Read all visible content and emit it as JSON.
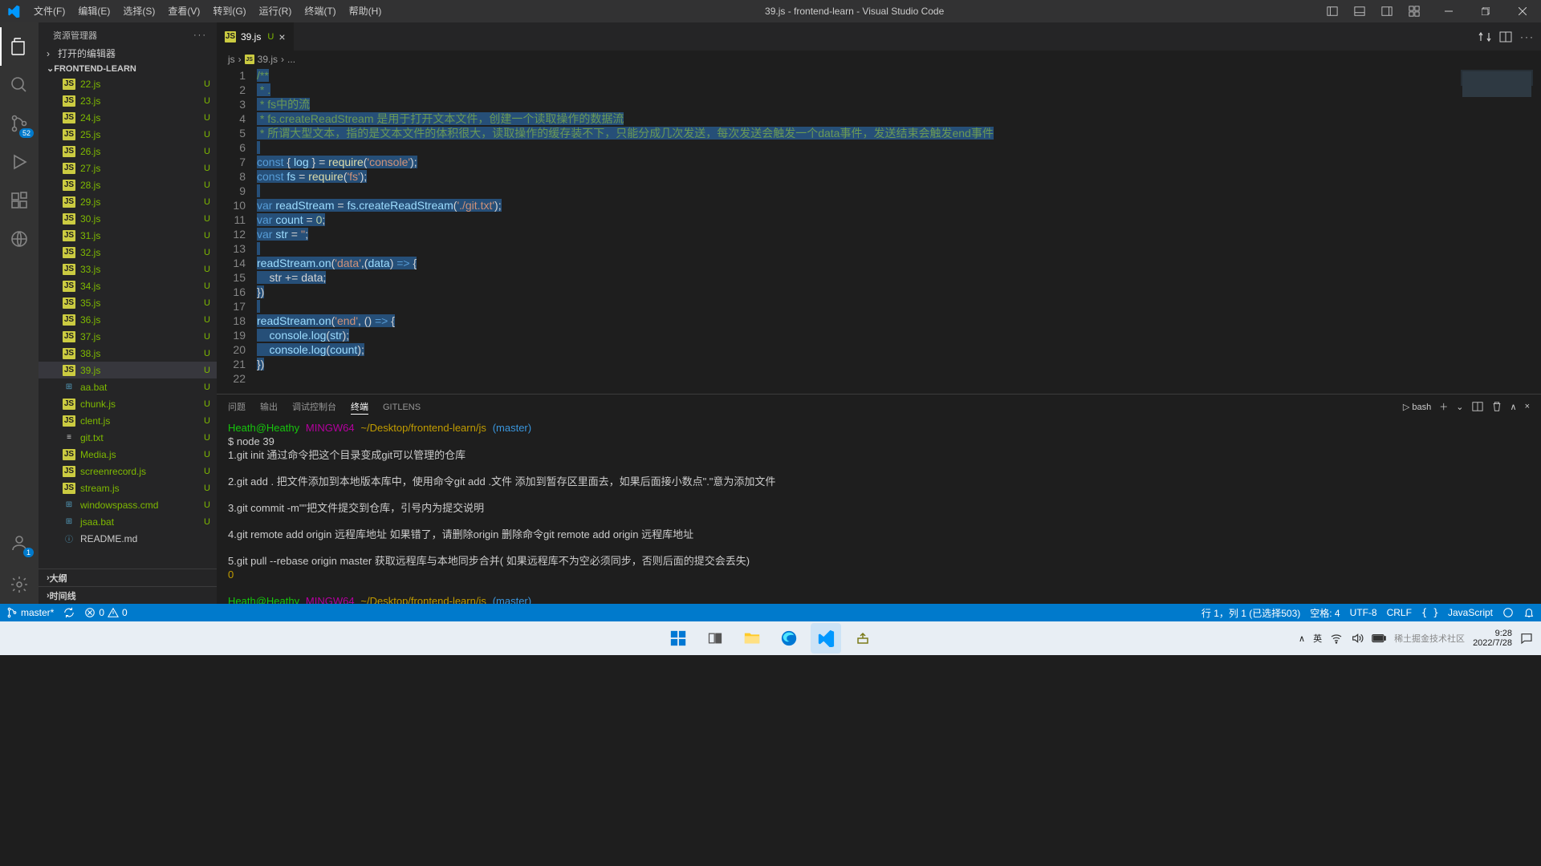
{
  "titlebar": {
    "menus": [
      "文件(F)",
      "编辑(E)",
      "选择(S)",
      "查看(V)",
      "转到(G)",
      "运行(R)",
      "终端(T)",
      "帮助(H)"
    ],
    "title": "39.js - frontend-learn - Visual Studio Code"
  },
  "sidebar": {
    "header": "资源管理器",
    "open_editors": "打开的编辑器",
    "folder": "FRONTEND-LEARN",
    "files": [
      {
        "name": "22.js",
        "type": "js",
        "status": "U"
      },
      {
        "name": "23.js",
        "type": "js",
        "status": "U"
      },
      {
        "name": "24.js",
        "type": "js",
        "status": "U"
      },
      {
        "name": "25.js",
        "type": "js",
        "status": "U"
      },
      {
        "name": "26.js",
        "type": "js",
        "status": "U"
      },
      {
        "name": "27.js",
        "type": "js",
        "status": "U"
      },
      {
        "name": "28.js",
        "type": "js",
        "status": "U"
      },
      {
        "name": "29.js",
        "type": "js",
        "status": "U"
      },
      {
        "name": "30.js",
        "type": "js",
        "status": "U"
      },
      {
        "name": "31.js",
        "type": "js",
        "status": "U"
      },
      {
        "name": "32.js",
        "type": "js",
        "status": "U"
      },
      {
        "name": "33.js",
        "type": "js",
        "status": "U"
      },
      {
        "name": "34.js",
        "type": "js",
        "status": "U"
      },
      {
        "name": "35.js",
        "type": "js",
        "status": "U"
      },
      {
        "name": "36.js",
        "type": "js",
        "status": "U"
      },
      {
        "name": "37.js",
        "type": "js",
        "status": "U"
      },
      {
        "name": "38.js",
        "type": "js",
        "status": "U"
      },
      {
        "name": "39.js",
        "type": "js",
        "status": "U",
        "active": true
      },
      {
        "name": "aa.bat",
        "type": "bat",
        "status": "U"
      },
      {
        "name": "chunk.js",
        "type": "js",
        "status": "U"
      },
      {
        "name": "clent.js",
        "type": "js",
        "status": "U"
      },
      {
        "name": "git.txt",
        "type": "txt",
        "status": "U"
      },
      {
        "name": "Media.js",
        "type": "js",
        "status": "U"
      },
      {
        "name": "screenrecord.js",
        "type": "js",
        "status": "U"
      },
      {
        "name": "stream.js",
        "type": "js",
        "status": "U"
      },
      {
        "name": "windowspass.cmd",
        "type": "bat",
        "status": "U"
      },
      {
        "name": "jsaa.bat",
        "type": "bat",
        "status": "U"
      },
      {
        "name": "README.md",
        "type": "md",
        "status": ""
      }
    ],
    "outline": "大纲",
    "timeline": "时间线"
  },
  "activitybar": {
    "scm_badge": "52",
    "accounts_badge": "1"
  },
  "tab": {
    "name": "39.js",
    "status": "U"
  },
  "breadcrumb": [
    "js",
    "39.js",
    "..."
  ],
  "code_lines": {
    "1": "/**",
    "2": " * .",
    "3": " * fs中的流",
    "4": " * fs.createReadStream 是用于打开文本文件，创建一个读取操作的数据流",
    "5": " * 所谓大型文本，指的是文本文件的体积很大，读取操作的缓存装不下，只能分成几次发送，每次发送会触发一个data事件，发送结束会触发end事件",
    "l7_const": "const",
    "l7_log": "log",
    "l7_require": "require",
    "l7_arg": "'console'",
    "l8_const": "const",
    "l8_fs": "fs",
    "l8_require": "require",
    "l8_arg": "'fs'",
    "l10_var": "var",
    "l10_rs": "readStream",
    "l10_call": "fs.createReadStream",
    "l10_arg": "'./git.txt'",
    "l11_var": "var",
    "l11_count": "count",
    "l11_val": "0",
    "l12_var": "var",
    "l12_str": "str",
    "l12_val": "''",
    "l14_rs": "readStream.on",
    "l14_ev": "'data'",
    "l14_param": "data",
    "l15_body": "    str += data;",
    "l18_rs": "readStream.on",
    "l18_ev": "'end'",
    "l19_log": "    console.log",
    "l19_arg": "str",
    "l20_log": "    console.log",
    "l20_arg": "count"
  },
  "panel": {
    "tabs": [
      "问题",
      "输出",
      "调试控制台",
      "终端",
      "GITLENS"
    ],
    "active_tab": 3,
    "shell": "bash"
  },
  "terminal": {
    "prompt_user": "Heath@Heathy",
    "prompt_sys": "MINGW64",
    "prompt_path": "~/Desktop/frontend-learn/js",
    "prompt_branch": "(master)",
    "cmd1": "$ node 39",
    "out1": "1.git init 通过命令把这个目录变成git可以管理的仓库",
    "out2": "2.git add . 把文件添加到本地版本库中，使用命令git add .文件 添加到暂存区里面去，如果后面接小数点\".\"意为添加文件",
    "out3": "3.git commit -m\"\"把文件提交到仓库，引号内为提交说明",
    "out4": "4.git remote add origin 远程库地址 如果错了，请删除origin 删除命令git remote add origin 远程库地址",
    "out5": "5.git pull --rebase origin master 获取远程库与本地同步合并( 如果远程库不为空必须同步，否则后面的提交会丢失)",
    "out5_num": "0",
    "dollar": "$"
  },
  "statusbar": {
    "branch": "master*",
    "errors": "0",
    "warnings": "0",
    "cursor": "行 1，列 1 (已选择503)",
    "spaces": "空格: 4",
    "encoding": "UTF-8",
    "eol": "CRLF",
    "lang": "JavaScript"
  },
  "taskbar": {
    "ime": "英",
    "time": "9:28",
    "date": "2022/7/28",
    "watermark": "稀土掘金技术社区"
  }
}
